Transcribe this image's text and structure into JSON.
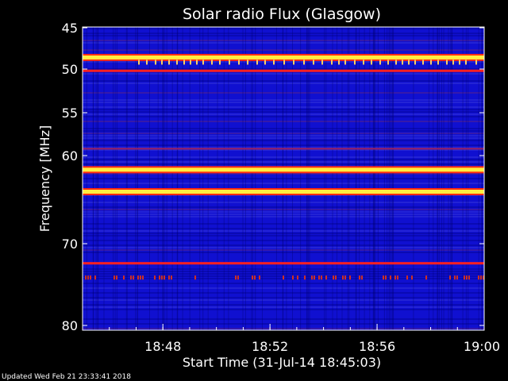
{
  "chart_data": {
    "type": "heatmap",
    "title": "Solar radio Flux (Glasgow)",
    "xlabel": "Start Time (31-Jul-14 18:45:03)",
    "ylabel": "Frequency [MHz]",
    "x_ticks": [
      "18:48",
      "18:52",
      "18:56",
      "19:00"
    ],
    "x_tick_minutes": [
      3,
      7,
      11,
      15
    ],
    "x_range_minutes": [
      0,
      15
    ],
    "y_ticks": [
      45,
      50,
      55,
      60,
      70,
      80
    ],
    "y_range": [
      44,
      80
    ],
    "y_axis_note": "frequency axis is non-linear (50-55 MHz and 70-80 MHz bands compressed)",
    "background_level": "low (blue)",
    "bands": [
      {
        "freq": 48.6,
        "color": "#ffee40",
        "intensity": "high",
        "extent": "full"
      },
      {
        "freq": 50.2,
        "color": "#ff2020",
        "intensity": "medium",
        "extent": "full"
      },
      {
        "freq": 59.2,
        "color": "#9b2060",
        "intensity": "low",
        "extent": "full"
      },
      {
        "freq": 61.6,
        "color": "#ffee40",
        "intensity": "high",
        "extent": "full"
      },
      {
        "freq": 64.1,
        "color": "#ffee40",
        "intensity": "high",
        "extent": "full"
      },
      {
        "freq": 72.4,
        "color": "#ff2020",
        "intensity": "medium",
        "extent": "full"
      },
      {
        "freq": 74.1,
        "color": "#d03020",
        "intensity": "low",
        "extent": "intermittent"
      }
    ],
    "palette": {
      "low": "#1010d0",
      "mid": "#2a2ab8",
      "warm": "#b01040",
      "hot": "#ff2a10",
      "max": "#ffff80"
    }
  },
  "footer": {
    "updated": "Updated Wed Feb 21 23:33:41 2018"
  }
}
